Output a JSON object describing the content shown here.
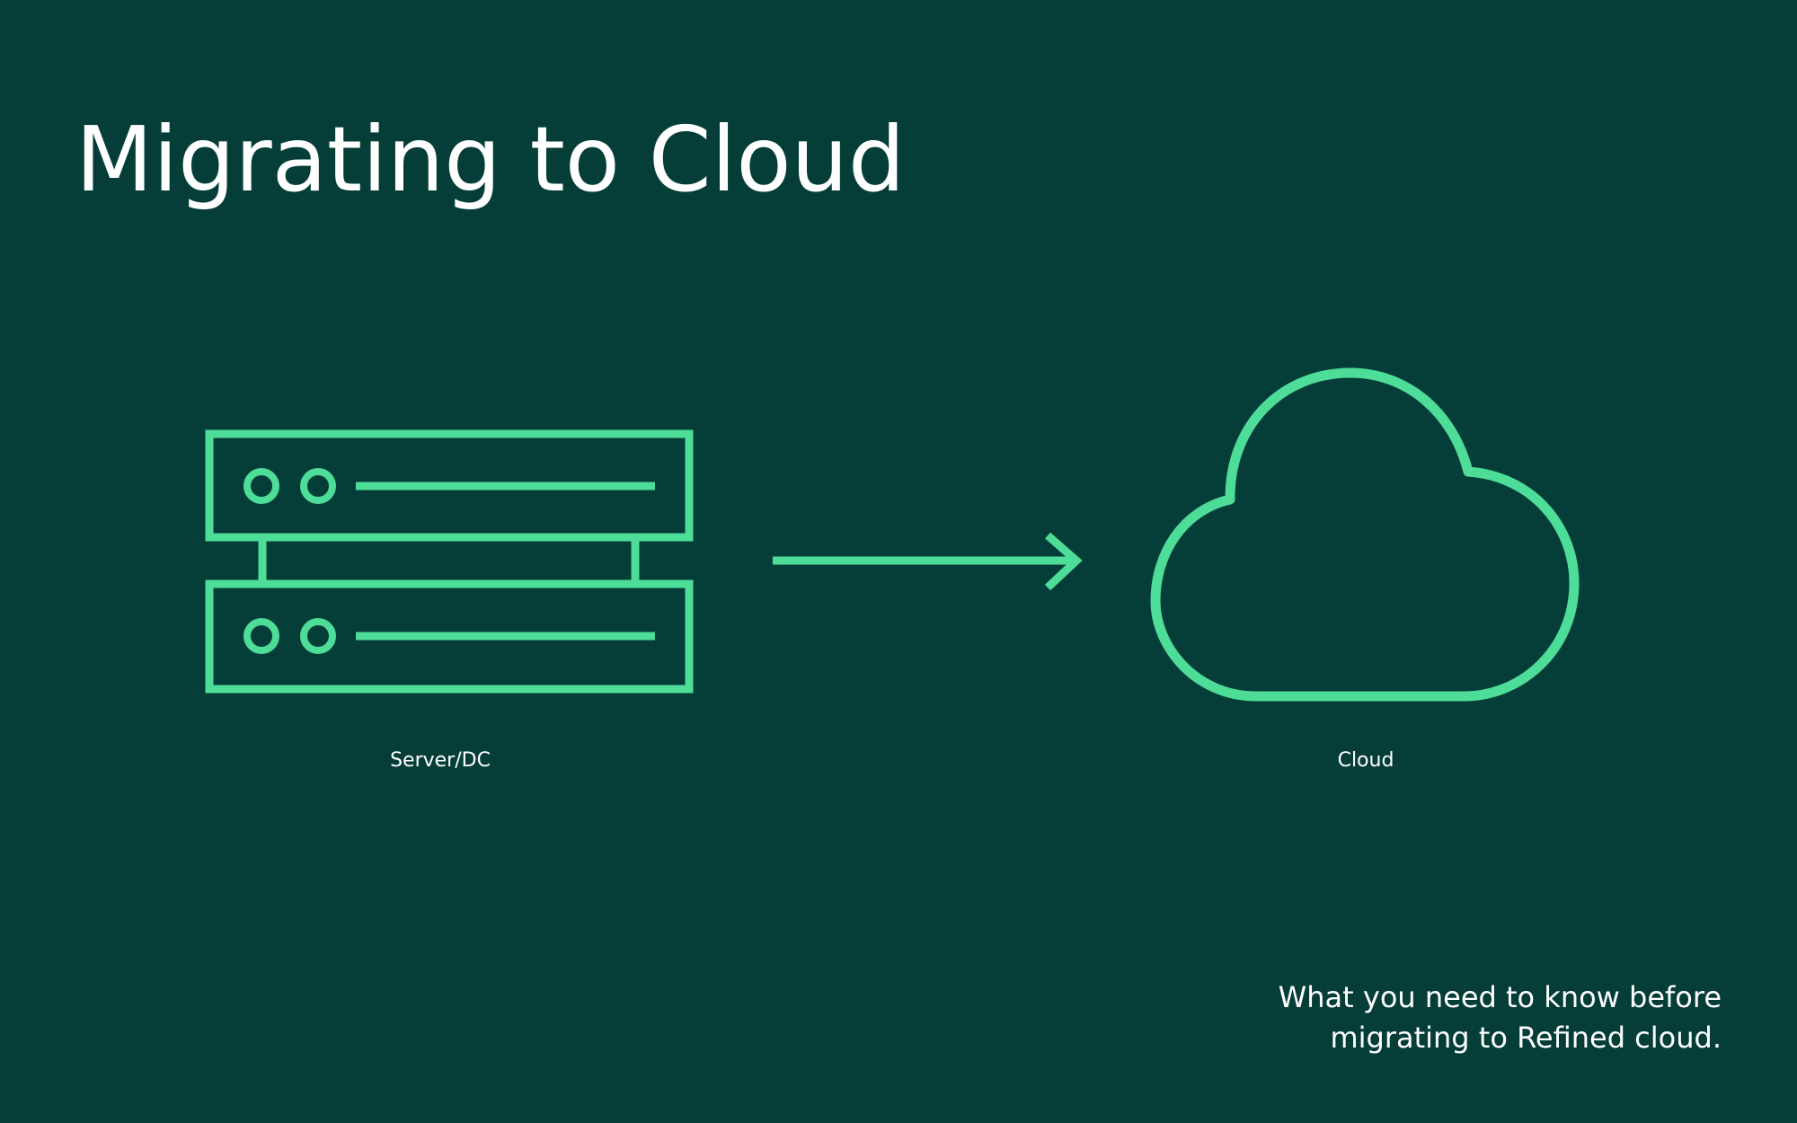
{
  "slide": {
    "title": "Migrating to Cloud",
    "tagline": {
      "line1": "What you need to know before",
      "line2": "migrating to Refined cloud."
    }
  },
  "diagram": {
    "source": {
      "label": "Server/DC",
      "icon": "server-icon"
    },
    "connector": {
      "icon": "arrow-right-icon"
    },
    "target": {
      "label": "Cloud",
      "icon": "cloud-icon"
    }
  },
  "colors": {
    "background": "#053d38",
    "accent": "#4ddd98",
    "text": "#ffffff"
  }
}
